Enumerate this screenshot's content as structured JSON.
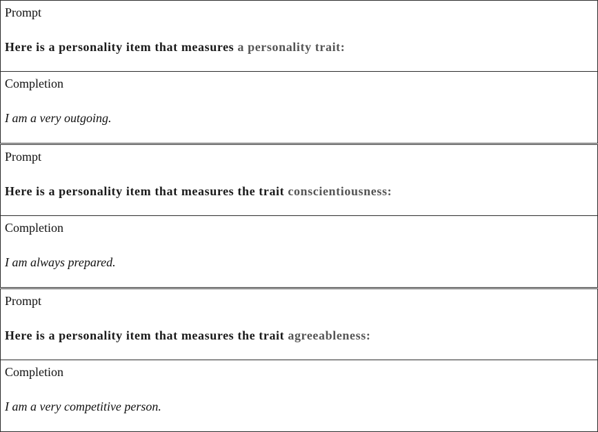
{
  "items": [
    {
      "prompt_label": "Prompt",
      "prompt_text": "Here is a personality item that measures ",
      "prompt_trait": "a personality trait:",
      "completion_label": "Completion",
      "completion_text": "I am a very outgoing."
    },
    {
      "prompt_label": "Prompt",
      "prompt_text": "Here is a personality item that measures the trait ",
      "prompt_trait": "conscientiousness:",
      "completion_label": "Completion",
      "completion_text": "I am always prepared."
    },
    {
      "prompt_label": "Prompt",
      "prompt_text": "Here is a personality item that measures the trait ",
      "prompt_trait": "agreeableness:",
      "completion_label": "Completion",
      "completion_text": "I am a very competitive person."
    }
  ]
}
